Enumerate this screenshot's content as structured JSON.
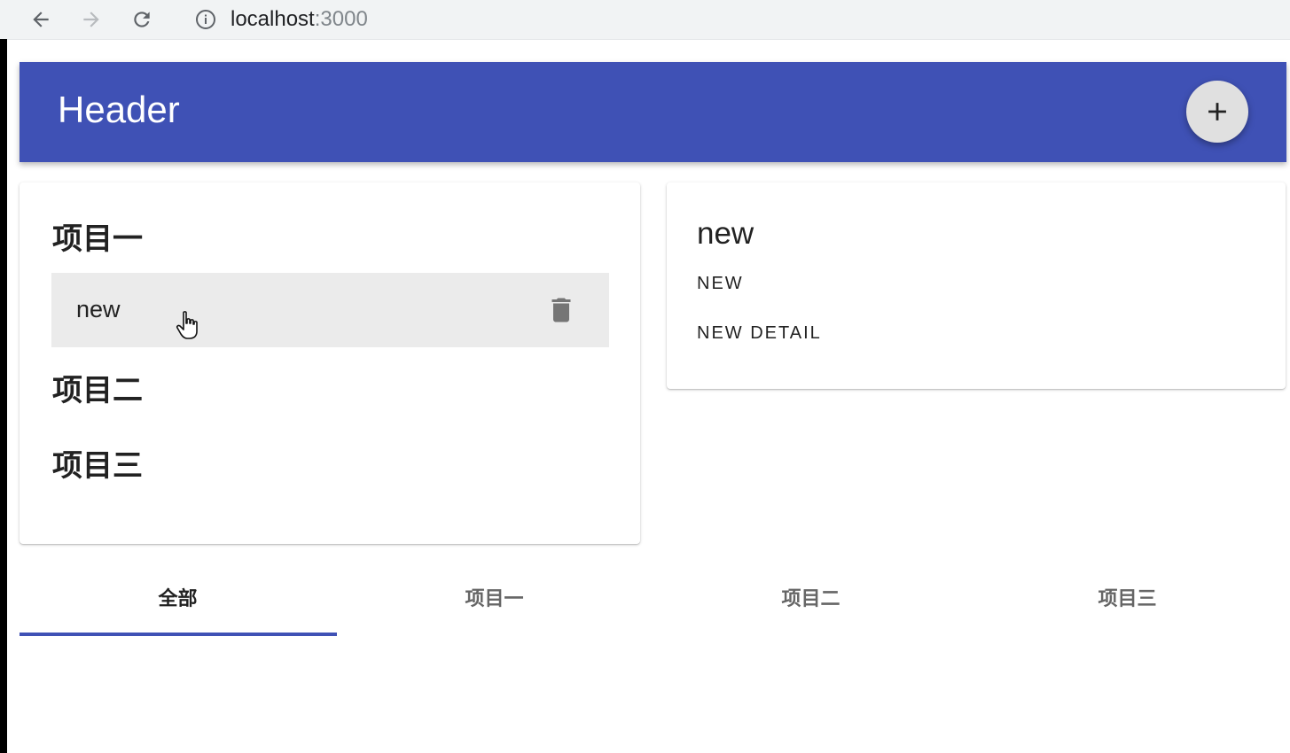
{
  "browser": {
    "url_host": "localhost",
    "url_port": ":3000"
  },
  "header": {
    "title": "Header",
    "add_icon": "plus-icon"
  },
  "todo_list": {
    "categories": [
      {
        "label": "项目一"
      },
      {
        "label": "项目二"
      },
      {
        "label": "项目三"
      }
    ],
    "items": [
      {
        "text": "new",
        "delete_icon": "trash-icon"
      }
    ]
  },
  "detail": {
    "title": "new",
    "buttons": [
      "NEW",
      "NEW DETAIL"
    ]
  },
  "tabs": {
    "items": [
      "全部",
      "项目一",
      "项目二",
      "项目三"
    ],
    "active_index": 0
  },
  "colors": {
    "primary": "#3f51b5",
    "fab": "#e0e0e0",
    "item_bg": "#ebebeb"
  }
}
